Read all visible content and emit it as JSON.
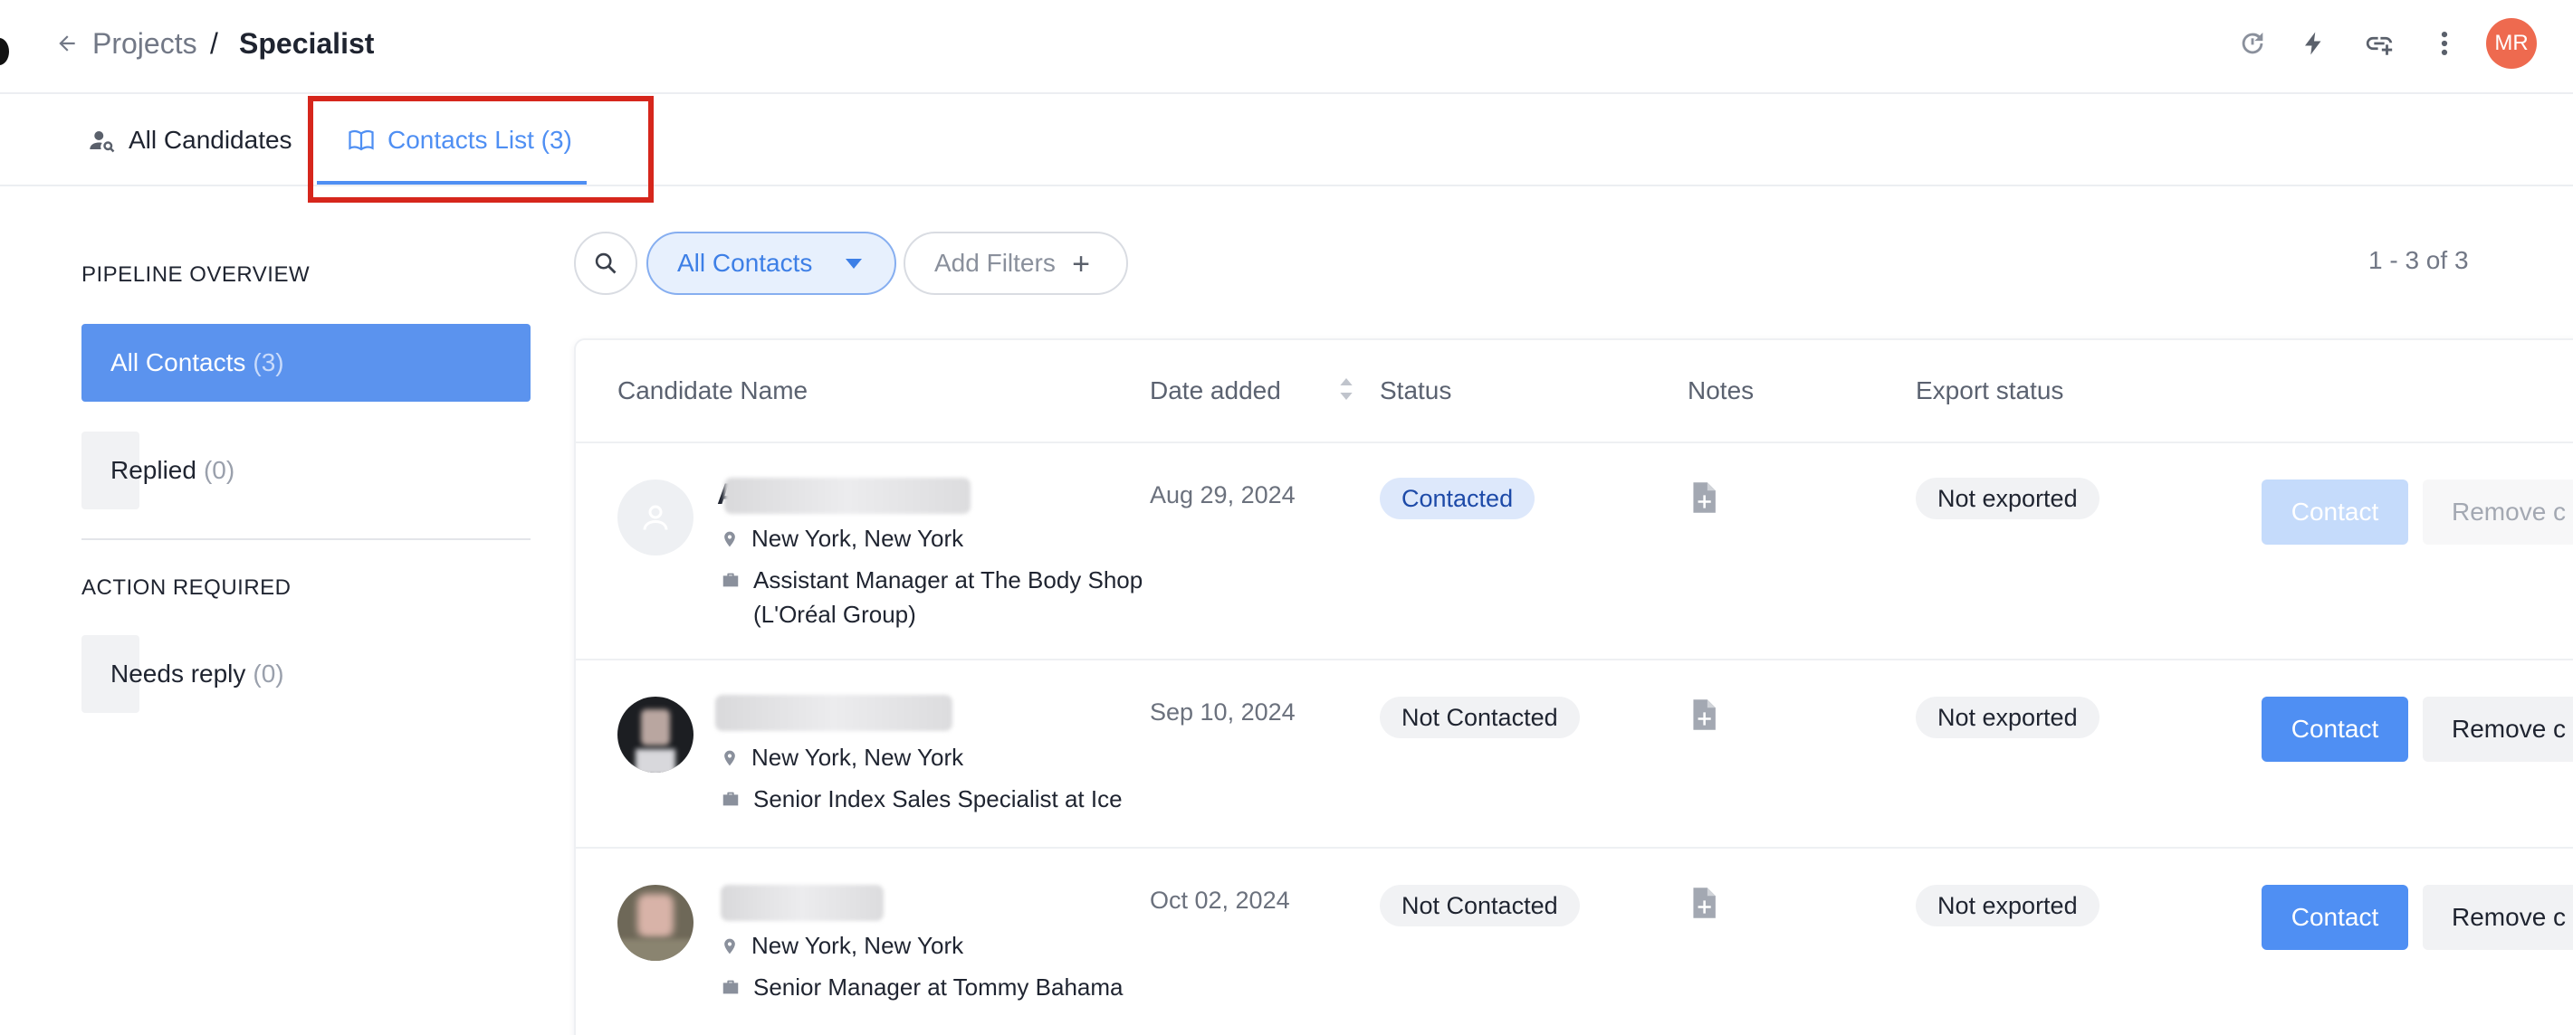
{
  "header": {
    "breadcrumb_parent": "Projects",
    "breadcrumb_sep": "/",
    "breadcrumb_current": "Specialist",
    "avatar_initials": "MR",
    "icons": [
      "history-icon",
      "bolt-icon",
      "link-add-icon",
      "more-vert-icon"
    ]
  },
  "tabs": [
    {
      "label": "All Candidates",
      "icon": "person-search-icon",
      "active": false
    },
    {
      "label": "Contacts List (3)",
      "icon": "book-icon",
      "active": true
    }
  ],
  "sidebar": {
    "pipeline_title": "PIPELINE OVERVIEW",
    "pipeline_items": [
      {
        "label": "All Contacts",
        "count": "(3)",
        "active": true
      },
      {
        "label": "Replied",
        "count": "(0)",
        "active": false
      }
    ],
    "action_title": "ACTION REQUIRED",
    "action_items": [
      {
        "label": "Needs reply",
        "count": "(0)"
      }
    ]
  },
  "filters": {
    "selected_view": "All Contacts",
    "add_filters_label": "Add Filters",
    "pagination": "1 - 3 of 3"
  },
  "table": {
    "columns": [
      "Candidate Name",
      "Date added",
      "Status",
      "Notes",
      "Export status"
    ],
    "rows": [
      {
        "initial": "A",
        "location": "New York, New York",
        "title": "Assistant Manager at The Body Shop (L'Oréal Group)",
        "date_added": "Aug 29, 2024",
        "status": "Contacted",
        "export_status": "Not exported",
        "contact_label": "Contact",
        "remove_label": "Remove c"
      },
      {
        "initial": "",
        "location": "New York, New York",
        "title": "Senior Index Sales Specialist at Ice",
        "date_added": "Sep 10, 2024",
        "status": "Not Contacted",
        "export_status": "Not exported",
        "contact_label": "Contact",
        "remove_label": "Remove c"
      },
      {
        "initial": "",
        "location": "New York, New York",
        "title": "Senior Manager at Tommy Bahama",
        "date_added": "Oct 02, 2024",
        "status": "Not Contacted",
        "export_status": "Not exported",
        "contact_label": "Contact",
        "remove_label": "Remove c"
      }
    ]
  },
  "colors": {
    "accent": "#4f8ff3",
    "avatar_bg": "#ee6a4f",
    "highlight": "#d6261c"
  }
}
